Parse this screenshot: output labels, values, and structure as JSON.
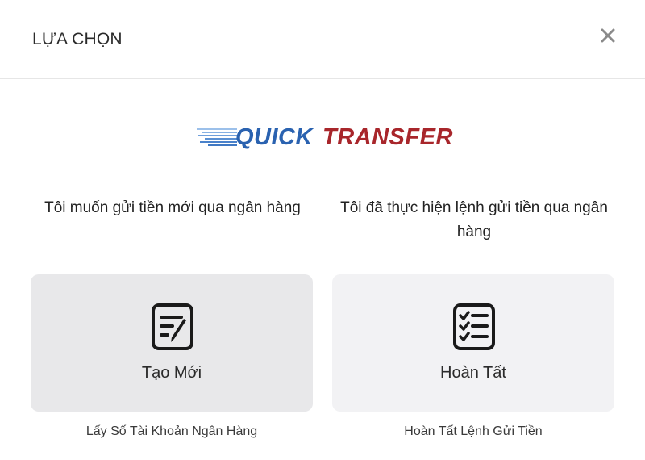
{
  "dialog": {
    "title": "LỰA CHỌN",
    "close_icon": "close-icon"
  },
  "logo": {
    "word1": "QUICK",
    "word2": "TRANSFER",
    "colors": {
      "word1": "#2a62b0",
      "word2": "#a8262b"
    }
  },
  "options": [
    {
      "question": "Tôi muốn gửi tiền mới qua ngân hàng",
      "button_label": "Tạo Mới",
      "icon": "edit-note-icon",
      "caption": "Lấy Số Tài Khoản Ngân Hàng"
    },
    {
      "question": "Tôi đã thực hiện lệnh gửi tiền qua ngân hàng",
      "button_label": "Hoàn Tất",
      "icon": "checklist-icon",
      "caption": "Hoàn Tất Lệnh Gửi Tiền"
    }
  ]
}
